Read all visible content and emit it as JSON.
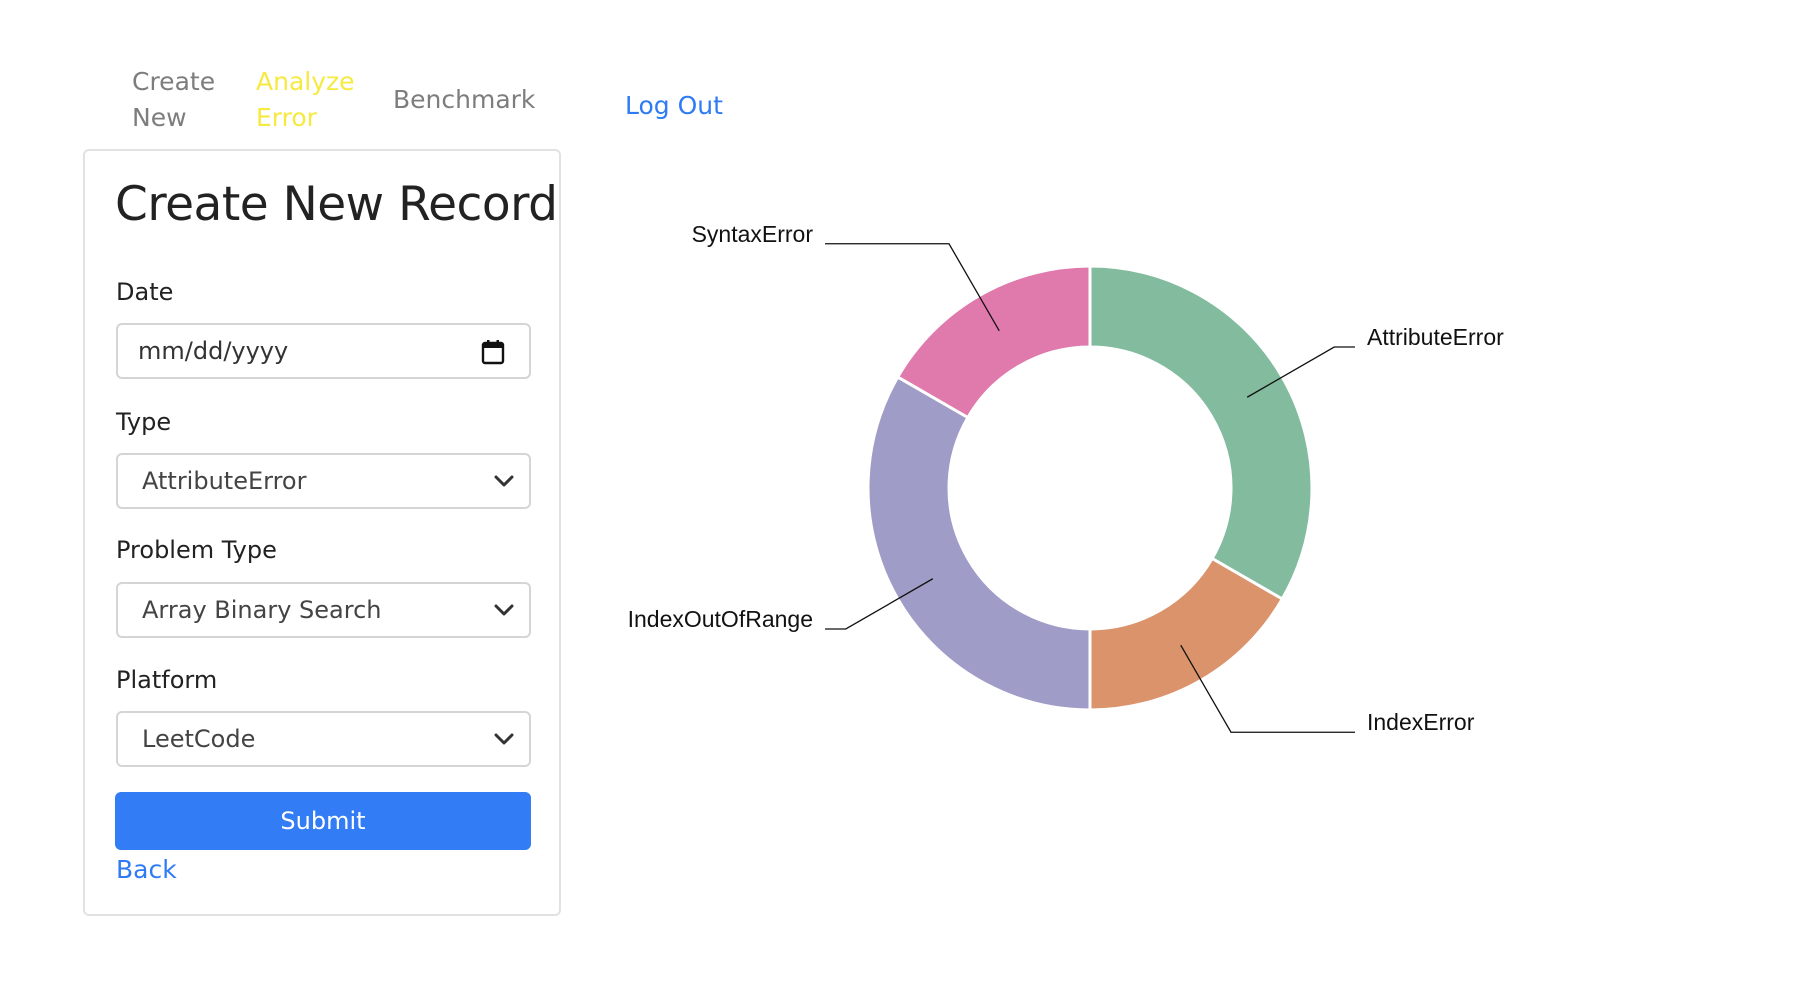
{
  "nav": {
    "create_new": [
      "Create",
      "New"
    ],
    "analyze_error": [
      "Analyze",
      "Error"
    ],
    "benchmark": "Benchmark",
    "log_out": "Log Out"
  },
  "form": {
    "title": "Create New Record",
    "date": {
      "label": "Date",
      "placeholder": "mm/dd/yyyy"
    },
    "type": {
      "label": "Type",
      "value": "AttributeError"
    },
    "problem_type": {
      "label": "Problem Type",
      "value": "Array Binary Search"
    },
    "platform": {
      "label": "Platform",
      "value": "LeetCode"
    },
    "submit_label": "Submit",
    "back_label": "Back"
  },
  "colors": {
    "link": "#2f7bf5",
    "active_nav": "#f6ea40",
    "inactive_nav": "#7d7d7d",
    "submit_bg": "#327cf5"
  },
  "chart_data": {
    "type": "pie",
    "donut": true,
    "categories": [
      "AttributeError",
      "IndexError",
      "IndexOutOfRange",
      "SyntaxError"
    ],
    "values": [
      2,
      1,
      2,
      1
    ],
    "colors": [
      "#83bb9f",
      "#da936a",
      "#9f9cc8",
      "#e07aac"
    ],
    "legend": "none",
    "labels": "outside-with-leader-lines"
  }
}
